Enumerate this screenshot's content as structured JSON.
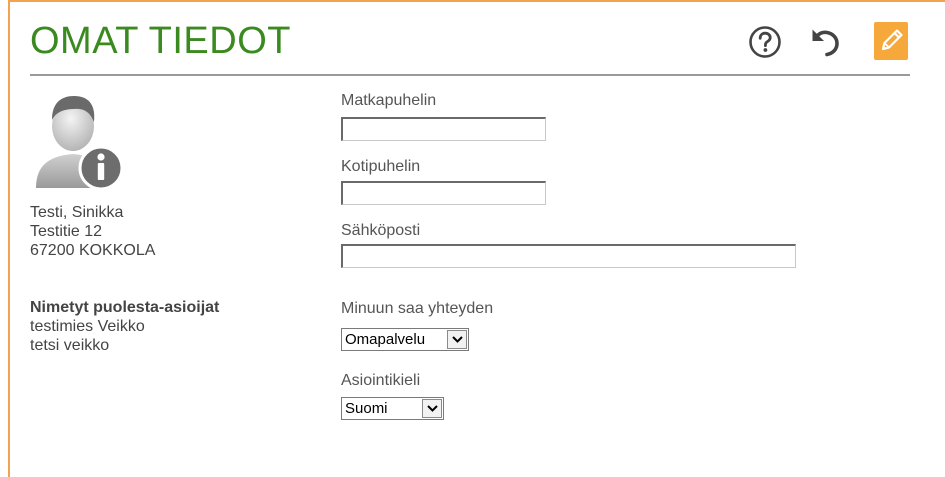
{
  "page": {
    "title": "OMAT TIEDOT",
    "accent_color": "#f3a24d",
    "title_color": "#3a8a1f"
  },
  "toolbar": {
    "help_icon": "question-circle-icon",
    "undo_icon": "undo-icon",
    "edit_icon": "pencil-icon"
  },
  "person": {
    "avatar_icon": "user-info-icon",
    "name": "Testi, Sinikka",
    "street": "Testitie 12",
    "postal": "67200 KOKKOLA"
  },
  "proxies": {
    "heading": "Nimetyt puolesta-asioijat",
    "items": [
      "testimies Veikko",
      "tetsi veikko"
    ]
  },
  "form": {
    "mobile_label": "Matkapuhelin",
    "mobile_value": "",
    "home_label": "Kotipuhelin",
    "home_value": "",
    "email_label": "Sähköposti",
    "email_value": "",
    "contact_label": "Minuun saa yhteyden",
    "contact_value": "Omapalvelu",
    "language_label": "Asiointikieli",
    "language_value": "Suomi"
  }
}
